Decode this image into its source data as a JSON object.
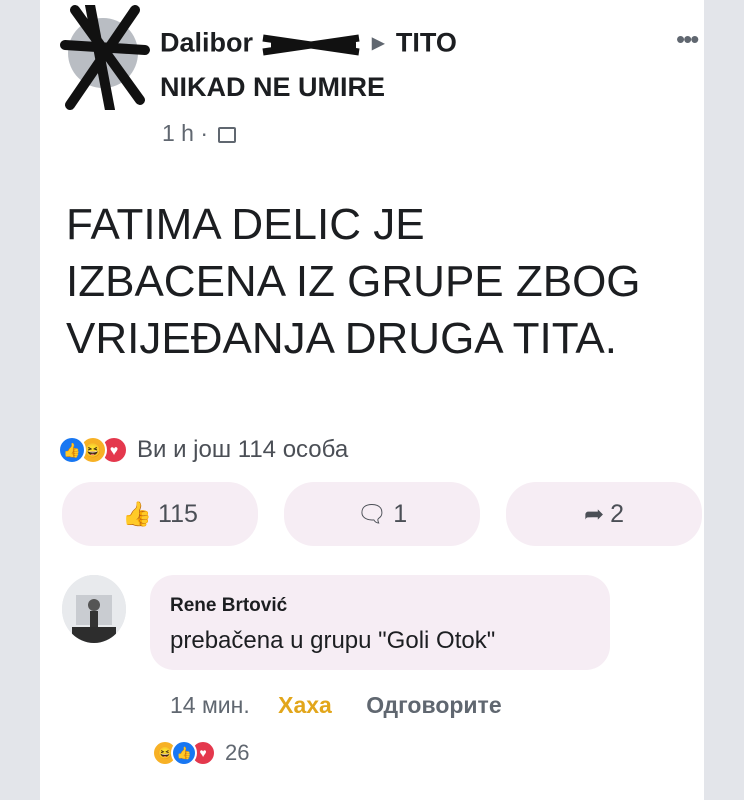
{
  "post": {
    "author_name": "Dalibor",
    "group_name_line1": "TITO",
    "group_name_line2": "NIKAD NE UMIRE",
    "time": "1 h",
    "more": "•••",
    "text_lines": [
      "FATIMA DELIC JE",
      "IZBACENA IZ GRUPE ZBOG",
      "VRIJEĐANJA DRUGA TITA."
    ]
  },
  "reactions": {
    "summary": "Ви и још 114 особа",
    "icons": [
      "like-icon",
      "haha-icon",
      "love-icon"
    ]
  },
  "actions": {
    "like_count": "115",
    "comment_count": "1",
    "share_count": "2"
  },
  "comment": {
    "author": "Rene Brtović",
    "text": "prebačena u grupu \"Goli Otok\"",
    "time": "14 мин.",
    "haha_label": "Хаха",
    "reply_label": "Одговорите",
    "reaction_count": "26"
  },
  "colors": {
    "like_blue": "#1877f2",
    "haha_yellow": "#f7b125",
    "love_red": "#e4384d",
    "button_bg": "#f6edf4"
  }
}
